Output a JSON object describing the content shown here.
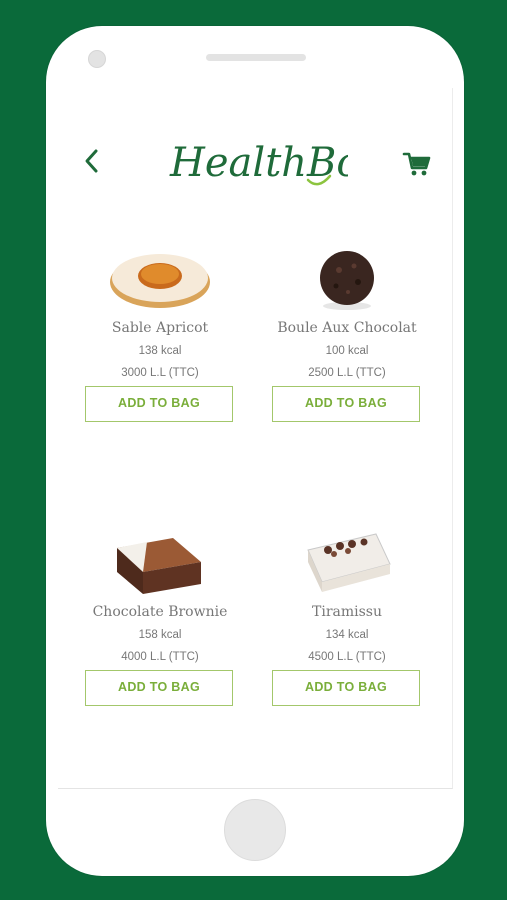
{
  "header": {
    "logo_text": "HealthBox",
    "back_icon": "chevron-left-icon",
    "cart_icon": "shopping-cart-icon"
  },
  "colors": {
    "background": "#0a6a3a",
    "brand_green": "#1f6b3a",
    "accent_green": "#7aae3a",
    "button_border": "#a3c76b",
    "text_gray": "#777777"
  },
  "products": [
    {
      "name": "Sable Apricot",
      "kcal": "138 kcal",
      "price": "3000 L.L (TTC)",
      "button": "ADD TO BAG",
      "image": "apricot-cookie"
    },
    {
      "name": "Boule Aux Chocolat",
      "kcal": "100 kcal",
      "price": "2500 L.L (TTC)",
      "button": "ADD TO BAG",
      "image": "chocolate-ball"
    },
    {
      "name": "Chocolate Brownie",
      "kcal": "158 kcal",
      "price": "4000 L.L (TTC)",
      "button": "ADD TO BAG",
      "image": "brownie"
    },
    {
      "name": "Tiramissu",
      "kcal": "134 kcal",
      "price": "4500 L.L (TTC)",
      "button": "ADD TO BAG",
      "image": "tiramisu-cup"
    }
  ]
}
